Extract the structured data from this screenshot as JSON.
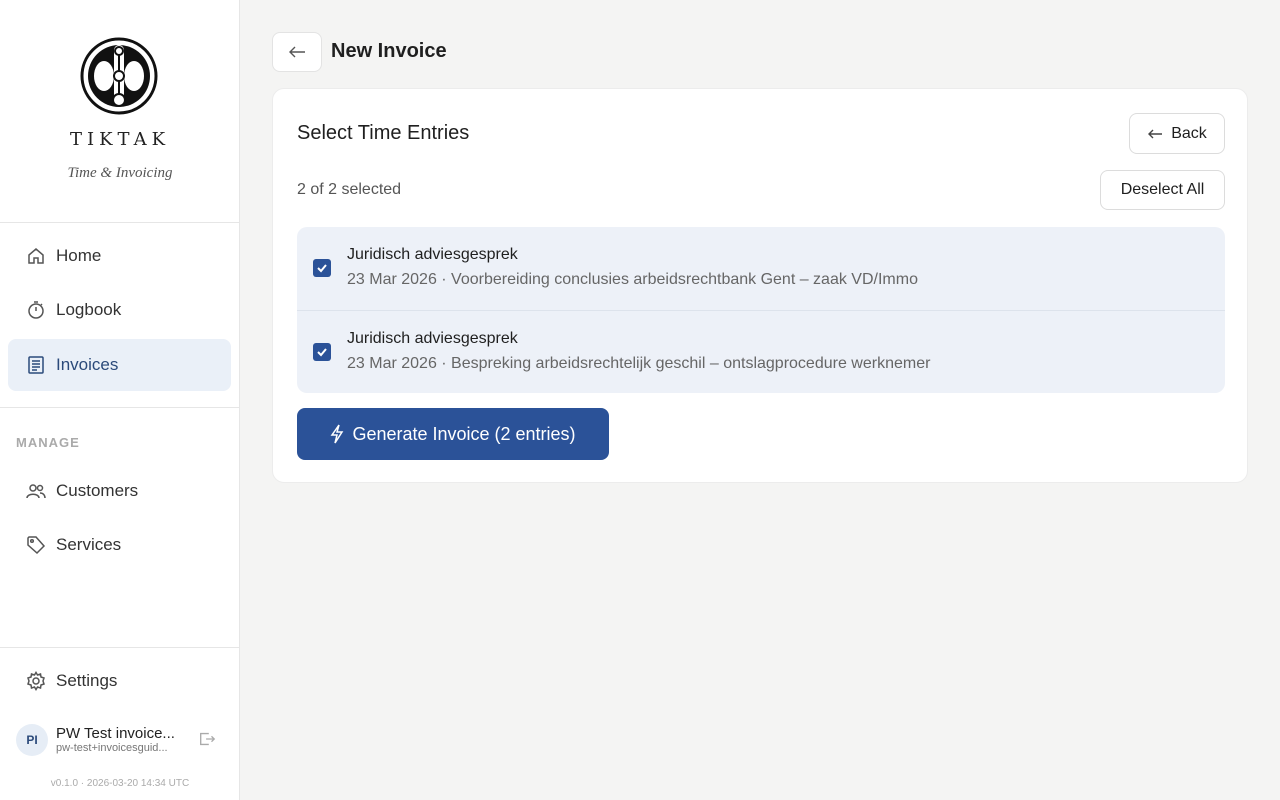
{
  "brand": {
    "name": "TIKTAK",
    "tagline": "Time & Invoicing"
  },
  "nav": {
    "main": [
      {
        "label": "Home",
        "icon": "home-icon"
      },
      {
        "label": "Logbook",
        "icon": "stopwatch-icon"
      },
      {
        "label": "Invoices",
        "icon": "invoice-icon",
        "active": true
      }
    ],
    "section_label": "MANAGE",
    "manage": [
      {
        "label": "Customers",
        "icon": "users-icon"
      },
      {
        "label": "Services",
        "icon": "tag-icon"
      }
    ],
    "settings": {
      "label": "Settings",
      "icon": "gear-icon"
    }
  },
  "user": {
    "initials": "PI",
    "name": "PW Test invoice...",
    "email": "pw-test+invoicesguid..."
  },
  "version": "v0.1.0 · 2026-03-20 14:34 UTC",
  "header": {
    "title": "New Invoice"
  },
  "card": {
    "title": "Select Time Entries",
    "back_label": "Back",
    "count_text": "2 of 2 selected",
    "deselect_label": "Deselect All",
    "entries": [
      {
        "title": "Juridisch adviesgesprek",
        "subtitle": "23 Mar 2026 · Voorbereiding conclusies arbeidsrechtbank Gent – zaak VD/Immo",
        "checked": true
      },
      {
        "title": "Juridisch adviesgesprek",
        "subtitle": "23 Mar 2026 · Bespreking arbeidsrechtelijk geschil – ontslagprocedure werknemer",
        "checked": true
      }
    ],
    "generate_label": "Generate Invoice (2 entries)"
  },
  "colors": {
    "accent": "#2b5298",
    "active_bg": "#eaf0f8",
    "entries_bg": "#edf1f8"
  }
}
